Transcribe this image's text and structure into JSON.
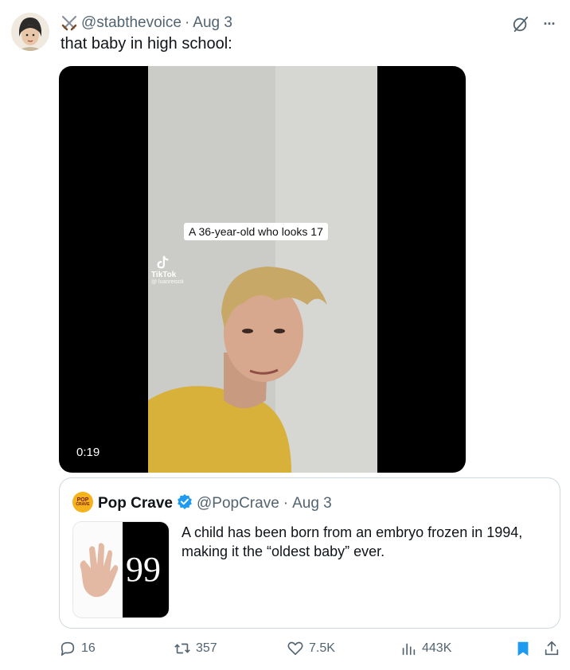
{
  "tweet": {
    "handle": "@stabthevoice",
    "date": "Aug 3",
    "separator": "·",
    "text": "that baby in high school:",
    "avatar_icon": "avatar-illustration",
    "badge_icon": "crossed-swords-icon"
  },
  "top_actions": {
    "grok_icon": "grok-slash-circle-icon",
    "more_label": "···"
  },
  "media": {
    "caption": "A 36-year-old who looks 17",
    "watermark_brand": "TikTok",
    "watermark_handle": "@ luanreisoli",
    "duration": "0:19"
  },
  "quote": {
    "logo_line1": "POP",
    "logo_line2": "CRAVE",
    "name": "Pop Crave",
    "handle": "@PopCrave",
    "separator": "·",
    "date": "Aug 3",
    "verified_icon": "verified-badge-icon",
    "thumb_text": "99",
    "text": "A child has been born from an embryo frozen in 1994, making it the “oldest baby” ever."
  },
  "actions": {
    "replies": "16",
    "reposts": "357",
    "likes": "7.5K",
    "views": "443K"
  },
  "colors": {
    "text": "#0f1419",
    "muted": "#536471",
    "accent": "#1d9bf0",
    "border": "#cfd9de"
  }
}
